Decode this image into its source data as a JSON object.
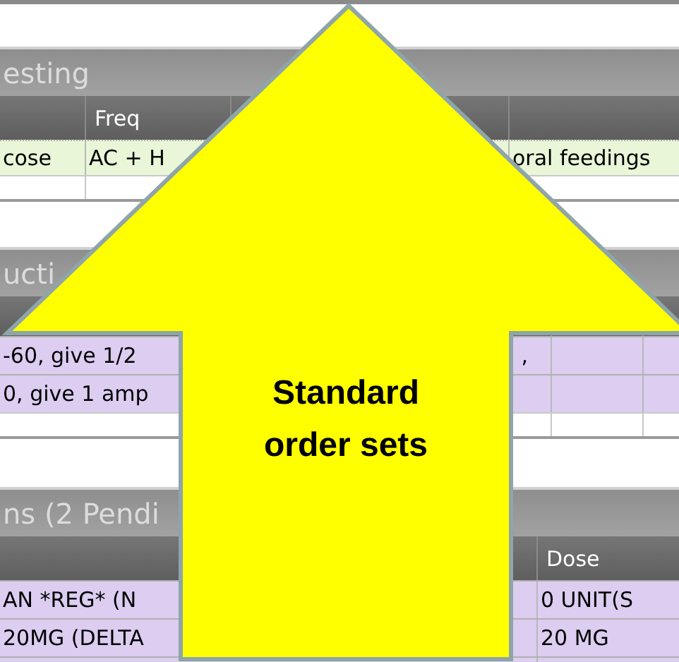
{
  "sections": [
    {
      "title": "esting",
      "header": {
        "column_2": "Freq"
      },
      "rows": [
        {
          "cells": {
            "column_1": "cose",
            "column_2": "AC + H",
            "column_4": "oral feedings"
          }
        }
      ]
    },
    {
      "title": "ucti",
      "rows": [
        {
          "cells": {
            "column_1": "-60, give 1/2",
            "column_1_end": ","
          }
        },
        {
          "cells": {
            "column_1": "0, give 1 amp"
          }
        }
      ]
    },
    {
      "title": "ns (2 Pendi",
      "header": {
        "column_2": "Dose"
      },
      "rows": [
        {
          "cells": {
            "column_1": "AN *REG* (N",
            "column_2": "0 UNIT(S"
          }
        },
        {
          "cells": {
            "column_1": "20MG (DELTA",
            "column_2": "20 MG"
          }
        },
        {
          "cells": {}
        }
      ]
    }
  ],
  "callout": {
    "text": "Standard order sets"
  }
}
